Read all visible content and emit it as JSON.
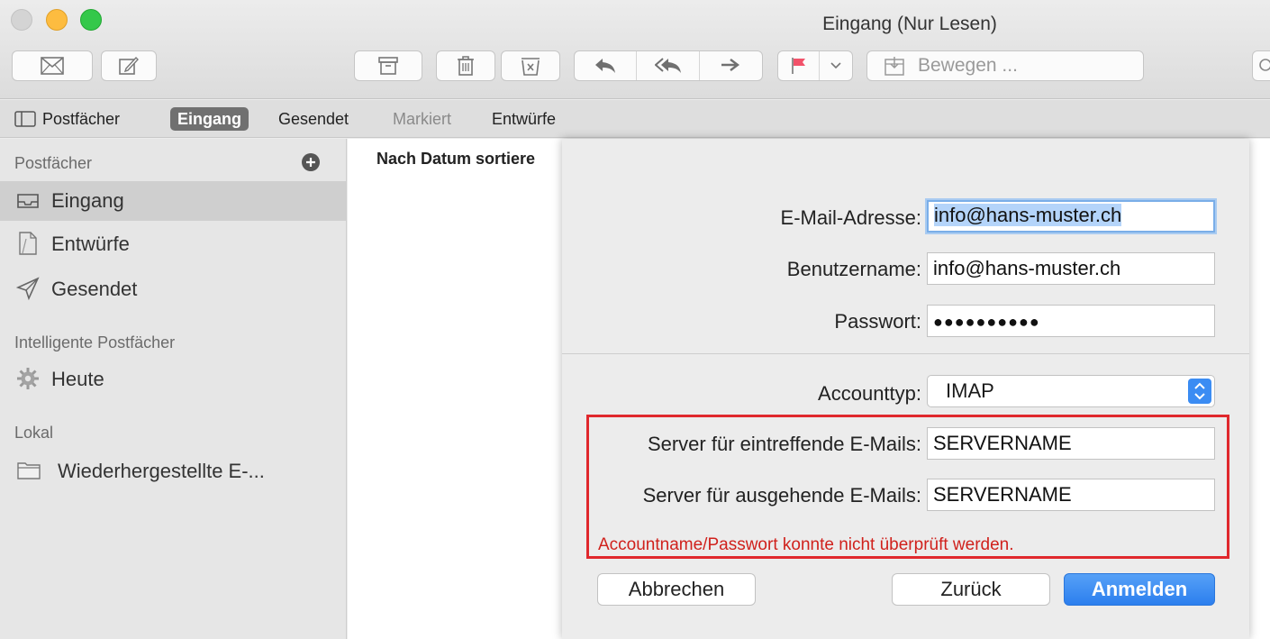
{
  "window": {
    "title": "Eingang (Nur Lesen)"
  },
  "toolbar": {
    "move_label": "Bewegen ..."
  },
  "favorites": [
    "Postfächer",
    "Eingang",
    "Gesendet",
    "Markiert",
    "Entwürfe"
  ],
  "sidebar": {
    "section_mailboxes": "Postfächer",
    "items": [
      "Eingang",
      "Entwürfe",
      "Gesendet"
    ],
    "section_smart": "Intelligente Postfächer",
    "smart_items": [
      "Heute"
    ],
    "section_local": "Lokal",
    "local_items": [
      "Wiederhergestellte E-..."
    ]
  },
  "messages": {
    "sort_header": "Nach Datum sortiere"
  },
  "dialog": {
    "email_label": "E-Mail-Adresse:",
    "email_value": "info@hans-muster.ch",
    "username_label": "Benutzername:",
    "username_value": "info@hans-muster.ch",
    "password_label": "Passwort:",
    "password_value": "●●●●●●●●●●",
    "accounttype_label": "Accounttyp:",
    "accounttype_value": "IMAP",
    "incoming_label": "Server für eintreffende E-Mails:",
    "incoming_value": "SERVERNAME",
    "outgoing_label": "Server für ausgehende E-Mails:",
    "outgoing_value": "SERVERNAME",
    "error": "Accountname/Passwort konnte nicht überprüft werden.",
    "cancel": "Abbrechen",
    "back": "Zurück",
    "login": "Anmelden"
  },
  "colors": {
    "accent": "#2c7fee",
    "error": "#d0211c",
    "highlight": "#e0282d"
  }
}
